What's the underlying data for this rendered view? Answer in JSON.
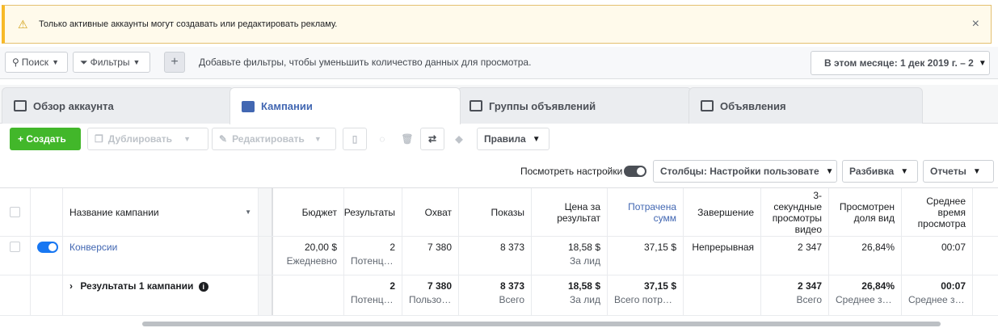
{
  "alert": {
    "text": "Только активные аккаунты могут создавать или редактировать рекламу.",
    "close": "×"
  },
  "filterbar": {
    "search": "Поиск",
    "filters": "Фильтры",
    "plus": "+",
    "hint": "Добавьте фильтры, чтобы уменьшить количество данных для просмотра.",
    "date": "В этом месяце: 1 дек 2019 г. – 2"
  },
  "tabs": [
    {
      "label": "Обзор аккаунта"
    },
    {
      "label": "Кампании"
    },
    {
      "label": "Группы объявлений"
    },
    {
      "label": "Объявления"
    }
  ],
  "toolbar": {
    "create": "+ Создать",
    "duplicate": "Дублировать",
    "edit": "Редактировать",
    "rules": "Правила"
  },
  "options": {
    "view_settings": "Посмотреть настройки",
    "columns": "Столбцы: Настройки пользовате",
    "breakdown": "Разбивка",
    "reports": "Отчеты"
  },
  "table": {
    "headers": {
      "name": "Название кампании",
      "budget": "Бюджет",
      "results": "Результаты",
      "reach": "Охват",
      "impressions": "Показы",
      "cpr": "Цена за результат",
      "spent": "Потрачена сумм",
      "ends": "Завершение",
      "video3s": "3-секундные просмотры видео",
      "viewed_share": "Просмотрен доля вид",
      "avg_time": "Среднее время просмотра"
    },
    "campaign": {
      "name": "Конверсии",
      "budget": "20,00 $",
      "budget_sub": "Ежедневно",
      "results": "2",
      "results_sub": "Потенци...",
      "reach": "7 380",
      "impressions": "8 373",
      "cpr": "18,58 $",
      "cpr_sub": "За лид",
      "spent": "37,15 $",
      "ends": "Непрерывная",
      "video3s": "2 347",
      "viewed_share": "26,84%",
      "avg_time": "00:07"
    },
    "summary": {
      "label": "Результаты 1 кампании",
      "results": "2",
      "results_sub": "Потенциа...",
      "reach": "7 380",
      "reach_sub": "Пользова...",
      "impressions": "8 373",
      "impressions_sub": "Всего",
      "cpr": "18,58 $",
      "cpr_sub": "За лид",
      "spent": "37,15 $",
      "spent_sub": "Всего потрач...",
      "video3s": "2 347",
      "video3s_sub": "Всего",
      "viewed_share": "26,84%",
      "viewed_share_sub": "Среднее зна...",
      "avg_time": "00:07",
      "avg_time_sub": "Среднее зна..."
    }
  }
}
